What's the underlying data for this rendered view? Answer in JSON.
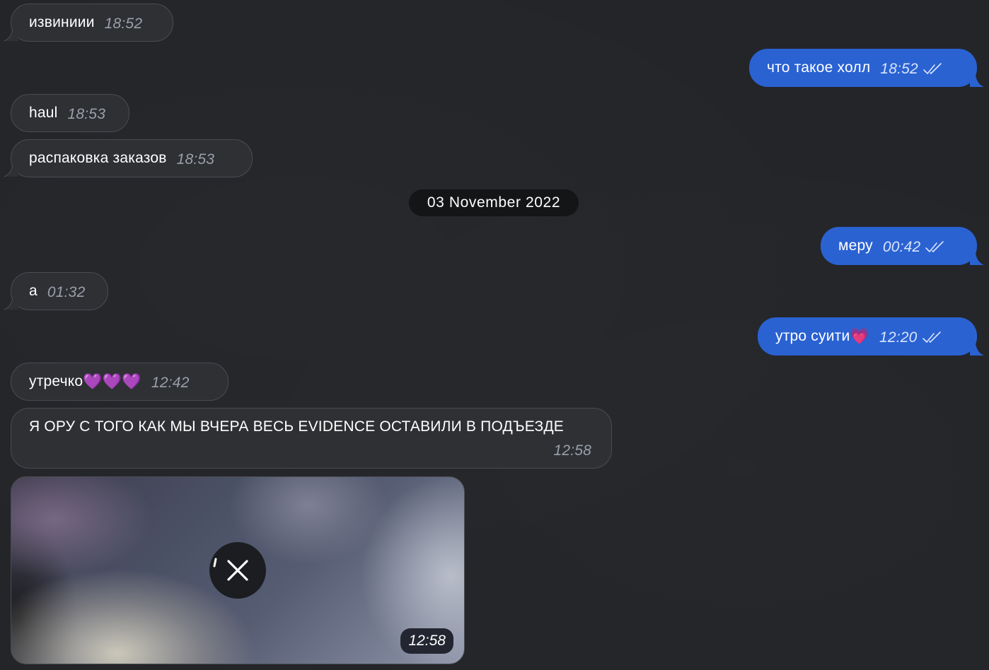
{
  "messages": [
    {
      "text": "извиниии",
      "time": "18:52"
    },
    {
      "text": "что такое холл",
      "time": "18:52"
    },
    {
      "text": "haul",
      "time": "18:53"
    },
    {
      "text": "распаковка заказов",
      "time": "18:53"
    },
    {
      "text": "меру",
      "time": "00:42"
    },
    {
      "text": "а",
      "time": "01:32"
    },
    {
      "text": "утро суити",
      "emoji": "💗",
      "time": "12:20"
    },
    {
      "text": "утречко",
      "emoji": "💜💜💜",
      "time": "12:42"
    },
    {
      "text": "Я ОРУ С ТОГО КАК МЫ ВЧЕРА ВЕСЬ EVIDENCE ОСТАВИЛИ В ПОДЪЕЗДЕ",
      "time": "12:58"
    }
  ],
  "date_separator": "03 November 2022",
  "media": {
    "time": "12:58",
    "cancel_icon": "close-icon",
    "progress_icon": "loading-spinner-icon"
  },
  "read_receipt_icon": "double-check-icon",
  "colors": {
    "background": "#232529",
    "incoming_bubble": "#2e3034",
    "outgoing_bubble": "#2a62d2",
    "date_pill": "#141517",
    "incoming_time": "#9aa0aa",
    "outgoing_time": "#d9e4fb"
  }
}
